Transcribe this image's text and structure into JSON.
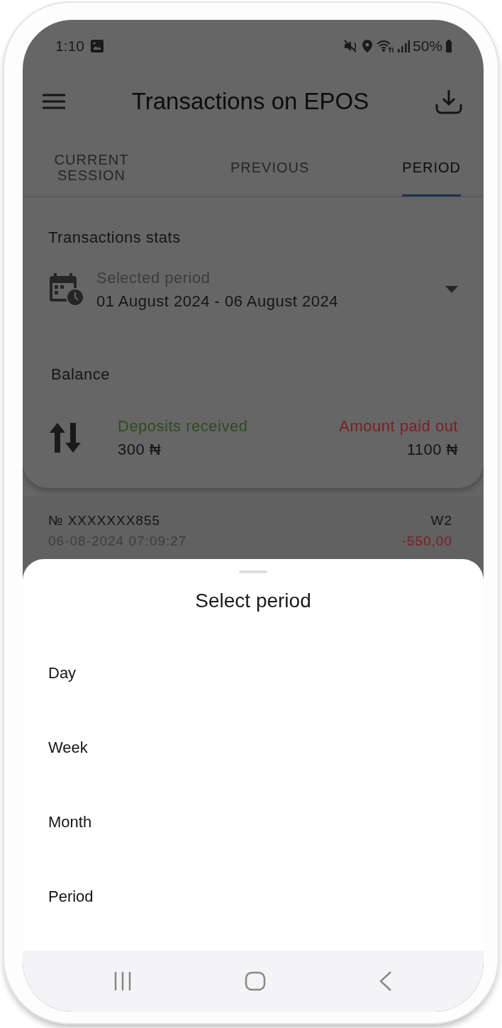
{
  "status_bar": {
    "time": "1:10",
    "battery": "50%"
  },
  "app_bar": {
    "title": "Transactions on EPOS"
  },
  "tabs": [
    {
      "label": "CURRENT SESSION",
      "selected": false
    },
    {
      "label": "PREVIOUS",
      "selected": false
    },
    {
      "label": "PERIOD",
      "selected": true
    }
  ],
  "stats": {
    "title": "Transactions stats",
    "period_label": "Selected period",
    "period_value": "01 August 2024 - 06 August 2024",
    "balance_title": "Balance",
    "deposits_label": "Deposits received",
    "deposits_value": "300 ₦",
    "paid_out_label": "Amount paid out",
    "paid_out_value": "1100 ₦"
  },
  "transactions": [
    {
      "number": "№ XXXXXXX855",
      "date": "06-08-2024 07:09:27",
      "terminal": "W2",
      "amount": "-550,00"
    }
  ],
  "sheet": {
    "title": "Select period",
    "options": [
      "Day",
      "Week",
      "Month",
      "Period"
    ]
  }
}
